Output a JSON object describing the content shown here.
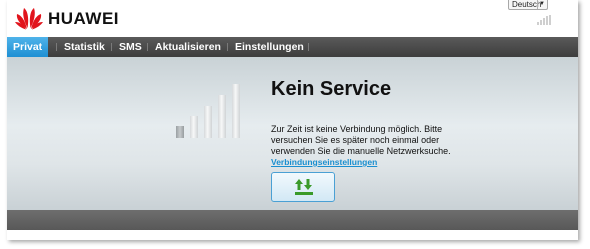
{
  "header": {
    "brand": "HUAWEI",
    "language_selected": "Deutsch",
    "logo_icon": "huawei-flower-logo",
    "signal_icon": "signal-strength-icon"
  },
  "nav": {
    "items": [
      {
        "label": "Privat",
        "active": true
      },
      {
        "label": "Statistik",
        "active": false
      },
      {
        "label": "SMS",
        "active": false
      },
      {
        "label": "Aktualisieren",
        "active": false
      },
      {
        "label": "Einstellungen",
        "active": false
      }
    ]
  },
  "status": {
    "title": "Kein Service",
    "description": "Zur Zeit ist keine Verbindung möglich. Bitte versuchen Sie es später noch einmal oder verwenden Sie die manuelle Netzwerksuche.",
    "link": "Verbindungseinstellungen",
    "connect_icon": "connect-arrows-icon",
    "signal_bars": 1
  },
  "colors": {
    "accent": "#1e8fd3",
    "nav_bg": "#3d3d3d",
    "logo_red": "#e1141c",
    "connect_green": "#3a9a2a"
  }
}
